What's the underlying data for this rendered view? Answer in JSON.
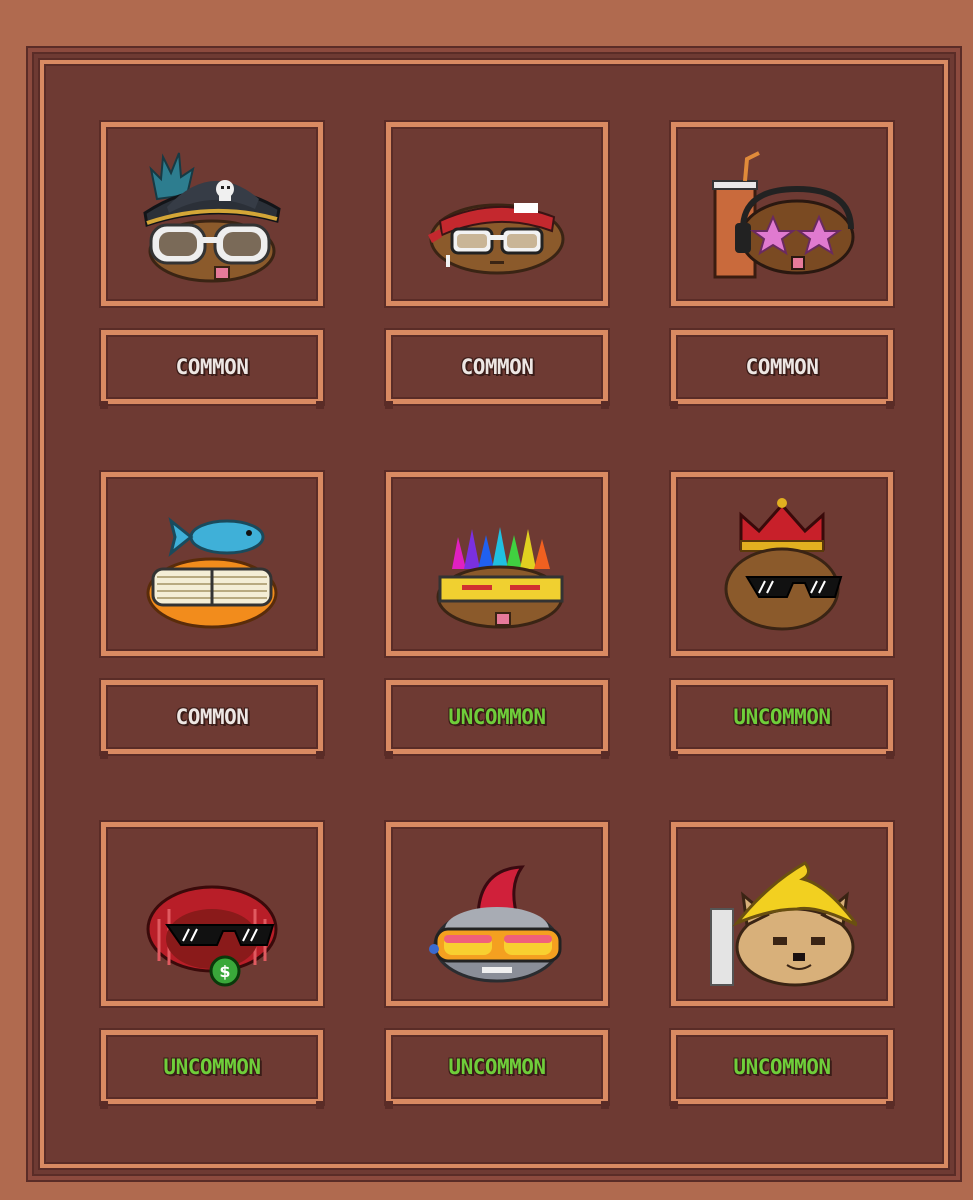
{
  "inventory": {
    "items": [
      {
        "name": "pirate-potato",
        "rarity": "COMMON",
        "rarity_color": "#ede6e3",
        "icon": "pirate-potato-icon"
      },
      {
        "name": "bandana-potato",
        "rarity": "COMMON",
        "rarity_color": "#ede6e3",
        "icon": "bandana-potato-icon"
      },
      {
        "name": "headphones-potato",
        "rarity": "COMMON",
        "rarity_color": "#ede6e3",
        "icon": "headphones-potato-icon"
      },
      {
        "name": "fish-potato",
        "rarity": "COMMON",
        "rarity_color": "#ede6e3",
        "icon": "fish-potato-icon"
      },
      {
        "name": "rainbow-hair-potato",
        "rarity": "UNCOMMON",
        "rarity_color": "#6fce3a",
        "icon": "rainbow-hair-potato-icon"
      },
      {
        "name": "crown-potato",
        "rarity": "UNCOMMON",
        "rarity_color": "#6fce3a",
        "icon": "crown-potato-icon"
      },
      {
        "name": "dreadlocks-potato",
        "rarity": "UNCOMMON",
        "rarity_color": "#6fce3a",
        "icon": "dreadlocks-potato-icon"
      },
      {
        "name": "mohawk-potato",
        "rarity": "UNCOMMON",
        "rarity_color": "#6fce3a",
        "icon": "mohawk-potato-icon"
      },
      {
        "name": "doge-banana-potato",
        "rarity": "UNCOMMON",
        "rarity_color": "#6fce3a",
        "icon": "doge-banana-potato-icon"
      }
    ]
  }
}
